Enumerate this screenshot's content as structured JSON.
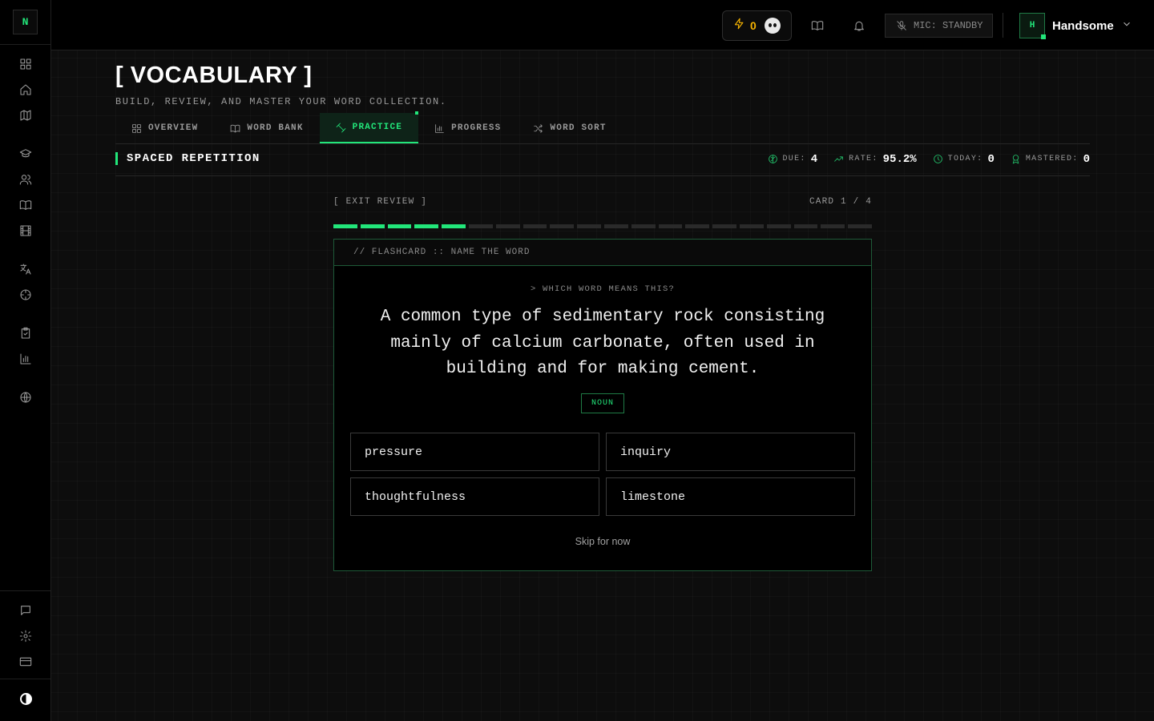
{
  "app": {
    "logo_letter": "N"
  },
  "sidebar": {
    "items": [
      {
        "icon": "dashboard-icon"
      },
      {
        "icon": "home-icon"
      },
      {
        "icon": "map-icon"
      },
      {
        "icon": "graduation-cap-icon"
      },
      {
        "icon": "users-icon"
      },
      {
        "icon": "book-icon"
      },
      {
        "icon": "film-icon"
      },
      {
        "icon": "translate-icon"
      },
      {
        "icon": "crosshair-icon"
      },
      {
        "icon": "clipboard-check-icon"
      },
      {
        "icon": "bar-chart-icon"
      },
      {
        "icon": "globe-icon"
      }
    ],
    "bottom_items": [
      {
        "icon": "message-icon"
      },
      {
        "icon": "gear-icon"
      },
      {
        "icon": "credit-card-icon"
      }
    ]
  },
  "header": {
    "streak_count": "0",
    "mic_label": "MIC: STANDBY",
    "user_initial": "H",
    "user_name": "Handsome"
  },
  "page": {
    "title": "[ VOCABULARY ]",
    "subtitle": "BUILD, REVIEW, AND MASTER YOUR WORD COLLECTION."
  },
  "tabs": [
    {
      "label": "OVERVIEW",
      "icon": "grid-icon",
      "active": false
    },
    {
      "label": "WORD BANK",
      "icon": "book-open-icon",
      "active": false
    },
    {
      "label": "PRACTICE",
      "icon": "dumbbell-icon",
      "active": true
    },
    {
      "label": "PROGRESS",
      "icon": "bar-chart-icon",
      "active": false
    },
    {
      "label": "WORD SORT",
      "icon": "shuffle-icon",
      "active": false
    }
  ],
  "spaced_repetition": {
    "title": "SPACED REPETITION",
    "stats": [
      {
        "label": "DUE:",
        "value": "4",
        "icon": "brain-icon"
      },
      {
        "label": "RATE:",
        "value": "95.2%",
        "icon": "trend-up-icon"
      },
      {
        "label": "TODAY:",
        "value": "0",
        "icon": "clock-icon"
      },
      {
        "label": "MASTERED:",
        "value": "0",
        "icon": "award-icon"
      }
    ]
  },
  "review": {
    "exit_label": "[ EXIT REVIEW ]",
    "card_counter": "CARD 1 / 4",
    "progress_segments_total": 20,
    "progress_segments_filled": 5,
    "accent_color": "#22e67a"
  },
  "flashcard": {
    "header": "// FLASHCARD :: NAME THE WORD",
    "prompt": "> WHICH WORD MEANS THIS?",
    "definition": "A common type of sedimentary rock consisting mainly of calcium carbonate, often used in building and for making cement.",
    "part_of_speech": "NOUN",
    "options": [
      "pressure",
      "inquiry",
      "thoughtfulness",
      "limestone"
    ],
    "skip_label": "Skip for now"
  }
}
